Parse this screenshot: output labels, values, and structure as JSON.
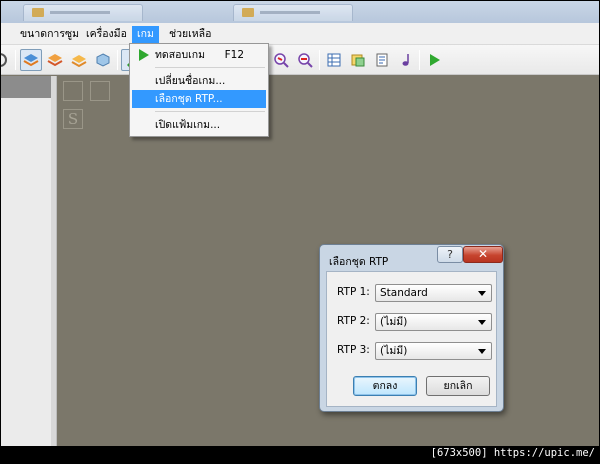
{
  "menubar": {
    "items": [
      "ขนาดการซูม",
      "เครื่องมือ",
      "เกม",
      "ช่วยเหลือ"
    ],
    "active": "เกม"
  },
  "dropdown": {
    "items": [
      {
        "label": "ทดสอบเกม",
        "shortcut": "F12",
        "icon": "play-icon"
      },
      {
        "label": "เปลี่ยนชื่อเกม..."
      },
      {
        "label": "เลือกชุด RTP...",
        "highlighted": true
      },
      {
        "label": "เปิดแฟ้มเกม..."
      }
    ]
  },
  "dialog": {
    "title": "เลือกชุด RTP",
    "help_label": "?",
    "close_label": "✕",
    "rows": [
      {
        "label": "RTP 1:",
        "value": "Standard"
      },
      {
        "label": "RTP 2:",
        "value": "(ไม่มี)"
      },
      {
        "label": "RTP 3:",
        "value": "(ไม่มี)"
      }
    ],
    "ok_label": "ตกลง",
    "cancel_label": "ยกเลิก"
  },
  "map": {
    "letter": "S"
  },
  "watermark": "[673x500] https://upic.me/",
  "colors": {
    "accent": "#3399ff",
    "map_bg": "#7b776a",
    "play": "#2fa82f"
  }
}
